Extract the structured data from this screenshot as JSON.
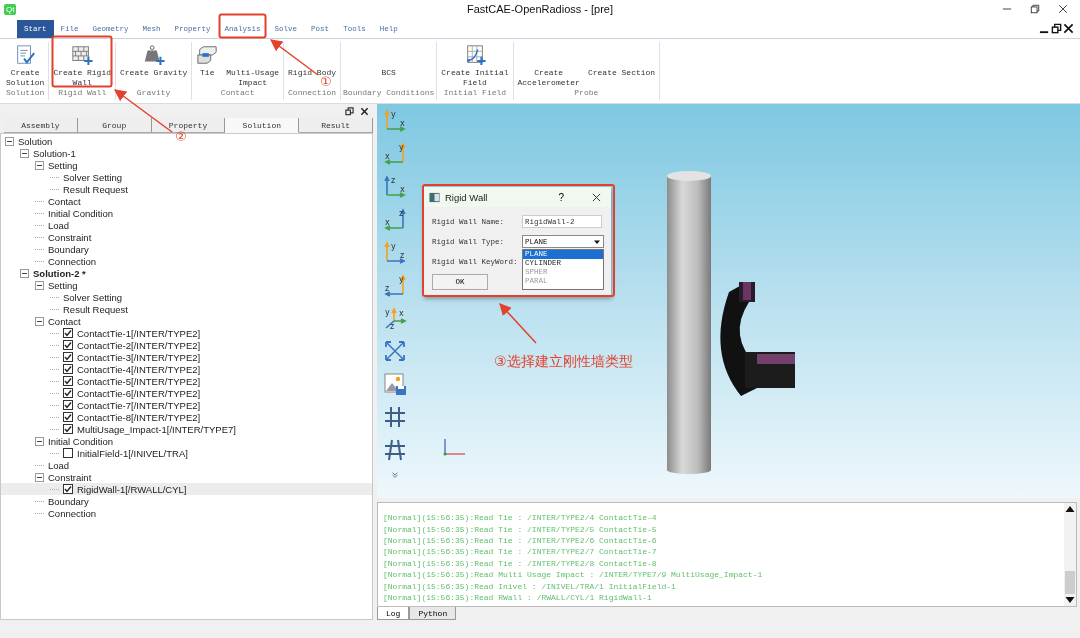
{
  "window": {
    "logo": "Qt",
    "title": "FastCAE-OpenRadioss - [pre]"
  },
  "menu_tabs": [
    {
      "label": "Start",
      "selected": true
    },
    {
      "label": "File",
      "selected": false
    },
    {
      "label": "Geometry",
      "selected": false
    },
    {
      "label": "Mesh",
      "selected": false
    },
    {
      "label": "Property",
      "selected": false
    },
    {
      "label": "Analysis",
      "selected": false
    },
    {
      "label": "Solve",
      "selected": false
    },
    {
      "label": "Post",
      "selected": false
    },
    {
      "label": "Tools",
      "selected": false
    },
    {
      "label": "Help",
      "selected": false
    }
  ],
  "ribbon": [
    {
      "label": "Solution",
      "buttons": [
        {
          "label": "Create\nSolution"
        }
      ]
    },
    {
      "label": "Rigid Wall",
      "buttons": [
        {
          "label": "Create Rigid\nWall"
        }
      ]
    },
    {
      "label": "Gravity",
      "buttons": [
        {
          "label": "Create Gravity"
        }
      ]
    },
    {
      "label": "Contact",
      "buttons": [
        {
          "label": "Tie"
        },
        {
          "label": "Multi-Usage\nImpact"
        }
      ]
    },
    {
      "label": "Connection",
      "buttons": [
        {
          "label": "Rigid Body"
        }
      ]
    },
    {
      "label": "Boundary Conditions",
      "buttons": [
        {
          "label": "BCS"
        }
      ]
    },
    {
      "label": "Initial Field",
      "buttons": [
        {
          "label": "Create Initial\nField"
        }
      ]
    },
    {
      "label": "Probe",
      "buttons": [
        {
          "label": "Create\nAccelerometer"
        },
        {
          "label": "Create Section"
        }
      ]
    }
  ],
  "left_panel": {
    "tabs": [
      {
        "label": "Assembly",
        "selected": false
      },
      {
        "label": "Group",
        "selected": false
      },
      {
        "label": "Property",
        "selected": false
      },
      {
        "label": "Solution",
        "selected": true
      },
      {
        "label": "Result",
        "selected": false
      }
    ],
    "tree": [
      {
        "label": "Solution",
        "expanded": true,
        "selected": false,
        "children": [
          {
            "label": "Solution-1",
            "expanded": true,
            "active": false,
            "selected": false,
            "children": [
              {
                "label": "Setting",
                "expanded": true,
                "selected": false,
                "children": [
                  {
                    "label": "Solver Setting",
                    "selected": false
                  },
                  {
                    "label": "Result Request",
                    "selected": false
                  }
                ]
              },
              {
                "label": "Contact",
                "selected": false
              },
              {
                "label": "Initial Condition",
                "selected": false
              },
              {
                "label": "Load",
                "selected": false
              },
              {
                "label": "Constraint",
                "selected": false
              },
              {
                "label": "Boundary",
                "selected": false
              },
              {
                "label": "Connection",
                "selected": false
              }
            ]
          },
          {
            "label": "Solution-2 *",
            "expanded": true,
            "active": true,
            "selected": false,
            "children": [
              {
                "label": "Setting",
                "expanded": true,
                "selected": false,
                "children": [
                  {
                    "label": "Solver Setting",
                    "selected": false
                  },
                  {
                    "label": "Result Request",
                    "selected": false
                  }
                ]
              },
              {
                "label": "Contact",
                "expanded": true,
                "selected": false,
                "children": [
                  {
                    "label": "ContactTie-1[/INTER/TYPE2]",
                    "checked": true,
                    "selected": false
                  },
                  {
                    "label": "ContactTie-2[/INTER/TYPE2]",
                    "checked": true,
                    "selected": false
                  },
                  {
                    "label": "ContactTie-3[/INTER/TYPE2]",
                    "checked": true,
                    "selected": false
                  },
                  {
                    "label": "ContactTie-4[/INTER/TYPE2]",
                    "checked": true,
                    "selected": false
                  },
                  {
                    "label": "ContactTie-5[/INTER/TYPE2]",
                    "checked": true,
                    "selected": false
                  },
                  {
                    "label": "ContactTie-6[/INTER/TYPE2]",
                    "checked": true,
                    "selected": false
                  },
                  {
                    "label": "ContactTie-7[/INTER/TYPE2]",
                    "checked": true,
                    "selected": false
                  },
                  {
                    "label": "ContactTie-8[/INTER/TYPE2]",
                    "checked": true,
                    "selected": false
                  },
                  {
                    "label": "MultiUsage_Impact-1[/INTER/TYPE7]",
                    "checked": true,
                    "selected": false
                  }
                ]
              },
              {
                "label": "Initial Condition",
                "expanded": true,
                "selected": false,
                "children": [
                  {
                    "label": "InitialField-1[/INIVEL/TRA]",
                    "checked": false,
                    "selected": false
                  }
                ]
              },
              {
                "label": "Load",
                "selected": false
              },
              {
                "label": "Constraint",
                "expanded": true,
                "selected": false,
                "children": [
                  {
                    "label": "RigidWall-1[/RWALL/CYL]",
                    "checked": true,
                    "selected": true
                  }
                ]
              },
              {
                "label": "Boundary",
                "selected": false
              },
              {
                "label": "Connection",
                "selected": false
              }
            ]
          }
        ]
      }
    ]
  },
  "view_toolbar": [
    {
      "kind": "axes",
      "up": "y",
      "across": "x",
      "mirror": false
    },
    {
      "kind": "axes",
      "up": "y",
      "across": "x",
      "mirror": true
    },
    {
      "kind": "axes",
      "up": "z",
      "across": "x",
      "mirror": false
    },
    {
      "kind": "axes",
      "up": "z",
      "across": "x",
      "mirror": true
    },
    {
      "kind": "axes",
      "up": "y",
      "across": "z",
      "mirror": false
    },
    {
      "kind": "axes",
      "up": "y",
      "across": "z",
      "mirror": true
    },
    {
      "kind": "iso",
      "up": "y",
      "across": "x",
      "depth": "z"
    },
    {
      "kind": "fit"
    },
    {
      "kind": "snapshot"
    },
    {
      "kind": "grid"
    },
    {
      "kind": "grid-slant"
    },
    {
      "kind": "more"
    }
  ],
  "dialog": {
    "title": "Rigid Wall",
    "help": "?",
    "fields": [
      {
        "kind": "text",
        "label": "Rigid Wall Name:",
        "value": "RigidWall-2"
      },
      {
        "kind": "select",
        "label": "Rigid Wall Type:",
        "value": "PLANE",
        "expanded": true,
        "options": [
          {
            "label": "PLANE",
            "selected": true,
            "disabled": false
          },
          {
            "label": "CYLINDER",
            "selected": false,
            "disabled": false
          },
          {
            "label": "SPHER",
            "selected": false,
            "disabled": true
          },
          {
            "label": "PARAL",
            "selected": false,
            "disabled": true
          }
        ]
      },
      {
        "kind": "covered",
        "label": "Rigid Wall KeyWord:"
      }
    ],
    "ok": "OK"
  },
  "log": {
    "lines": [
      "[Normal](15:56:35):Read Tie : /INTER/TYPE2/4 ContactTie-4",
      "[Normal](15:56:35):Read Tie : /INTER/TYPE2/5 ContactTie-5",
      "[Normal](15:56:35):Read Tie : /INTER/TYPE2/6 ContactTie-6",
      "[Normal](15:56:35):Read Tie : /INTER/TYPE2/7 ContactTie-7",
      "[Normal](15:56:35):Read Tie : /INTER/TYPE2/8 ContactTie-8",
      "[Normal](15:56:35):Read Multi Usage Impact : /INTER/TYPE7/9 MultiUsage_Impact-1",
      "[Normal](15:56:35):Read Inivel : /INIVEL/TRA/1 InitialField-1",
      "[Normal](15:56:35):Read RWall : /RWALL/CYL/1 RigidWall-1"
    ],
    "tabs": [
      {
        "label": "Log",
        "selected": true
      },
      {
        "label": "Python",
        "selected": false
      }
    ]
  },
  "annotations": {
    "step_1": "①",
    "step_2": "②",
    "caption": "③选择建立刚性墙类型"
  }
}
